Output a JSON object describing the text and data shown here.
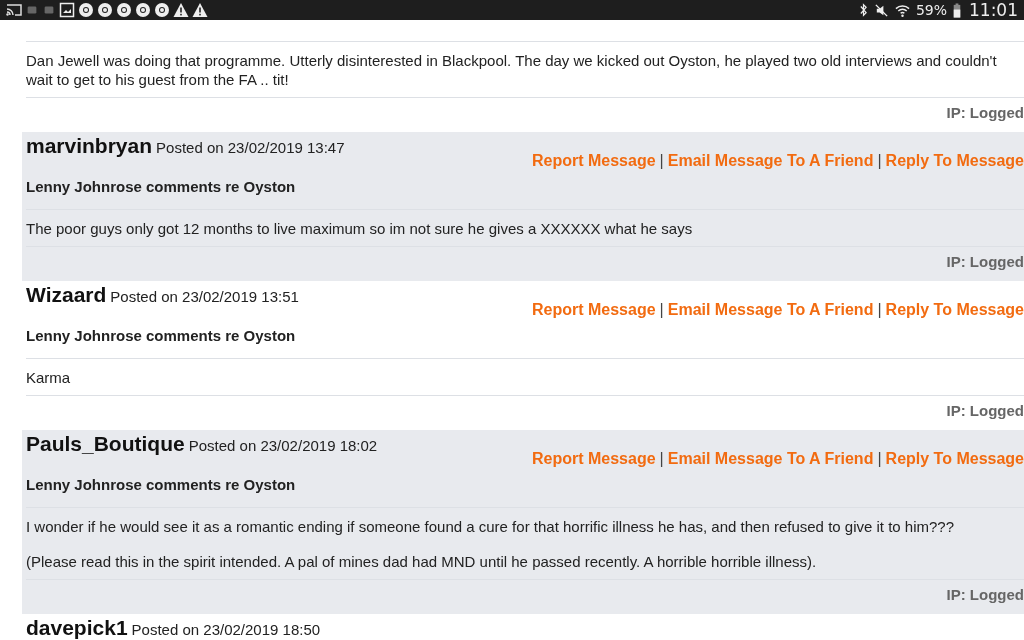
{
  "status_bar": {
    "left_icons": [
      {
        "kind": "cast"
      },
      {
        "kind": "square"
      },
      {
        "kind": "square"
      },
      {
        "kind": "image"
      },
      {
        "kind": "chrome"
      },
      {
        "kind": "chrome"
      },
      {
        "kind": "chrome"
      },
      {
        "kind": "chrome"
      },
      {
        "kind": "chrome"
      },
      {
        "kind": "warning"
      },
      {
        "kind": "warning"
      }
    ],
    "right_icons": [
      {
        "kind": "bluetooth"
      },
      {
        "kind": "mute"
      },
      {
        "kind": "wifi"
      }
    ],
    "battery": "59%",
    "time": "11:01"
  },
  "posts": [
    {
      "shaded": false,
      "body": [
        "Dan Jewell was doing that programme. Utterly disinterested in Blackpool. The day we kicked out Oyston, he played two old interviews and couldn't wait to get to his guest from the FA .. tit!"
      ],
      "ip": "IP: Logged"
    },
    {
      "shaded": true,
      "username": "marvinbryan",
      "posted": "Posted on 23/02/2019 13:47",
      "links": [
        "Report Message",
        "|",
        "Email Message To A Friend",
        "|",
        "Reply To Message"
      ],
      "subject": "Lenny Johnrose comments re Oyston",
      "body": [
        "The poor guys only got 12 months to live maximum so im not sure he gives a XXXXXX what he says"
      ],
      "ip": "IP: Logged"
    },
    {
      "shaded": false,
      "username": "Wizaard",
      "posted": "Posted on 23/02/2019 13:51",
      "links": [
        "Report Message",
        "|",
        "Email Message To A Friend",
        "|",
        "Reply To Message"
      ],
      "subject": "Lenny Johnrose comments re Oyston",
      "body": [
        "Karma"
      ],
      "ip": "IP: Logged"
    },
    {
      "shaded": true,
      "username": "Pauls_Boutique",
      "posted": "Posted on 23/02/2019 18:02",
      "links": [
        "Report Message",
        "|",
        "Email Message To A Friend",
        "|",
        "Reply To Message"
      ],
      "subject": "Lenny Johnrose comments re Oyston",
      "body": [
        "I wonder if he would see it as a romantic ending if someone found a cure for that horrific illness he has, and then refused to give it to him???",
        "(Please read this in the spirit intended. A pal of mines dad had MND until he passed recently. A horrible horrible illness)."
      ],
      "ip": "IP: Logged"
    },
    {
      "shaded": false,
      "username": "davepick1",
      "posted": "Posted on 23/02/2019 18:50"
    }
  ]
}
